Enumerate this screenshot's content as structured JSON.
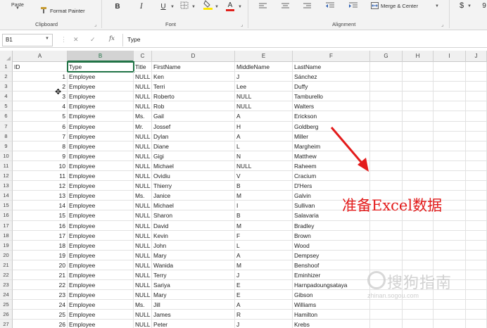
{
  "ribbon": {
    "paste_label": "Paste",
    "format_painter_label": "Format Painter",
    "clipboard_label": "Clipboard",
    "font_label": "Font",
    "alignment_label": "Alignment",
    "merge_center_label": "Merge & Center",
    "bold": "B",
    "italic": "I",
    "underline": "U",
    "font_color_glyph": "A",
    "currency": "$",
    "number_partial": "9",
    "fill_color": "#ffe800",
    "font_color": "#e0201b"
  },
  "formula_bar": {
    "name_box": "B1",
    "fx": "fx",
    "formula": "Type"
  },
  "columns": [
    {
      "letter": "A",
      "selected": false
    },
    {
      "letter": "B",
      "selected": true
    },
    {
      "letter": "C",
      "selected": false
    },
    {
      "letter": "D",
      "selected": false
    },
    {
      "letter": "E",
      "selected": false
    },
    {
      "letter": "F",
      "selected": false
    },
    {
      "letter": "G",
      "selected": false
    },
    {
      "letter": "H",
      "selected": false
    },
    {
      "letter": "I",
      "selected": false
    },
    {
      "letter": "J",
      "selected": false
    }
  ],
  "header_row": [
    "ID",
    "Type",
    "Title",
    "FirstName",
    "MiddleName",
    "LastName"
  ],
  "data_rows": [
    [
      "1",
      "Employee",
      "NULL",
      "Ken",
      "J",
      "Sánchez"
    ],
    [
      "2",
      "Employee",
      "NULL",
      "Terri",
      "Lee",
      "Duffy"
    ],
    [
      "3",
      "Employee",
      "NULL",
      "Roberto",
      "NULL",
      "Tamburello"
    ],
    [
      "4",
      "Employee",
      "NULL",
      "Rob",
      "NULL",
      "Walters"
    ],
    [
      "5",
      "Employee",
      "Ms.",
      "Gail",
      "A",
      "Erickson"
    ],
    [
      "6",
      "Employee",
      "Mr.",
      "Jossef",
      "H",
      "Goldberg"
    ],
    [
      "7",
      "Employee",
      "NULL",
      "Dylan",
      "A",
      "Miller"
    ],
    [
      "8",
      "Employee",
      "NULL",
      "Diane",
      "L",
      "Margheim"
    ],
    [
      "9",
      "Employee",
      "NULL",
      "Gigi",
      "N",
      "Matthew"
    ],
    [
      "10",
      "Employee",
      "NULL",
      "Michael",
      "NULL",
      "Raheem"
    ],
    [
      "11",
      "Employee",
      "NULL",
      "Ovidiu",
      "V",
      "Cracium"
    ],
    [
      "12",
      "Employee",
      "NULL",
      "Thierry",
      "B",
      "D'Hers"
    ],
    [
      "13",
      "Employee",
      "Ms.",
      "Janice",
      "M",
      "Galvin"
    ],
    [
      "14",
      "Employee",
      "NULL",
      "Michael",
      "I",
      "Sullivan"
    ],
    [
      "15",
      "Employee",
      "NULL",
      "Sharon",
      "B",
      "Salavaria"
    ],
    [
      "16",
      "Employee",
      "NULL",
      "David",
      "M",
      "Bradley"
    ],
    [
      "17",
      "Employee",
      "NULL",
      "Kevin",
      "F",
      "Brown"
    ],
    [
      "18",
      "Employee",
      "NULL",
      "John",
      "L",
      "Wood"
    ],
    [
      "19",
      "Employee",
      "NULL",
      "Mary",
      "A",
      "Dempsey"
    ],
    [
      "20",
      "Employee",
      "NULL",
      "Wanida",
      "M",
      "Benshoof"
    ],
    [
      "21",
      "Employee",
      "NULL",
      "Terry",
      "J",
      "Eminhizer"
    ],
    [
      "22",
      "Employee",
      "NULL",
      "Sariya",
      "E",
      "Harnpadoungsataya"
    ],
    [
      "23",
      "Employee",
      "NULL",
      "Mary",
      "E",
      "Gibson"
    ],
    [
      "24",
      "Employee",
      "Ms.",
      "Jill",
      "A",
      "Williams"
    ],
    [
      "25",
      "Employee",
      "NULL",
      "James",
      "R",
      "Hamilton"
    ],
    [
      "26",
      "Employee",
      "NULL",
      "Peter",
      "J",
      "Krebs"
    ]
  ],
  "annotation": {
    "text": "准备Excel数据",
    "color": "#e31b1b"
  },
  "watermark": {
    "text": "搜狗指南",
    "url": "zhinan.sogou.com"
  },
  "icons": [
    "format-painter-icon",
    "borders-icon",
    "fill-color-icon",
    "align-left-icon",
    "align-center-icon",
    "align-right-icon",
    "decrease-indent-icon",
    "increase-indent-icon",
    "merge-center-icon",
    "cancel-icon",
    "enter-icon",
    "fx-icon",
    "cursor-icon"
  ]
}
